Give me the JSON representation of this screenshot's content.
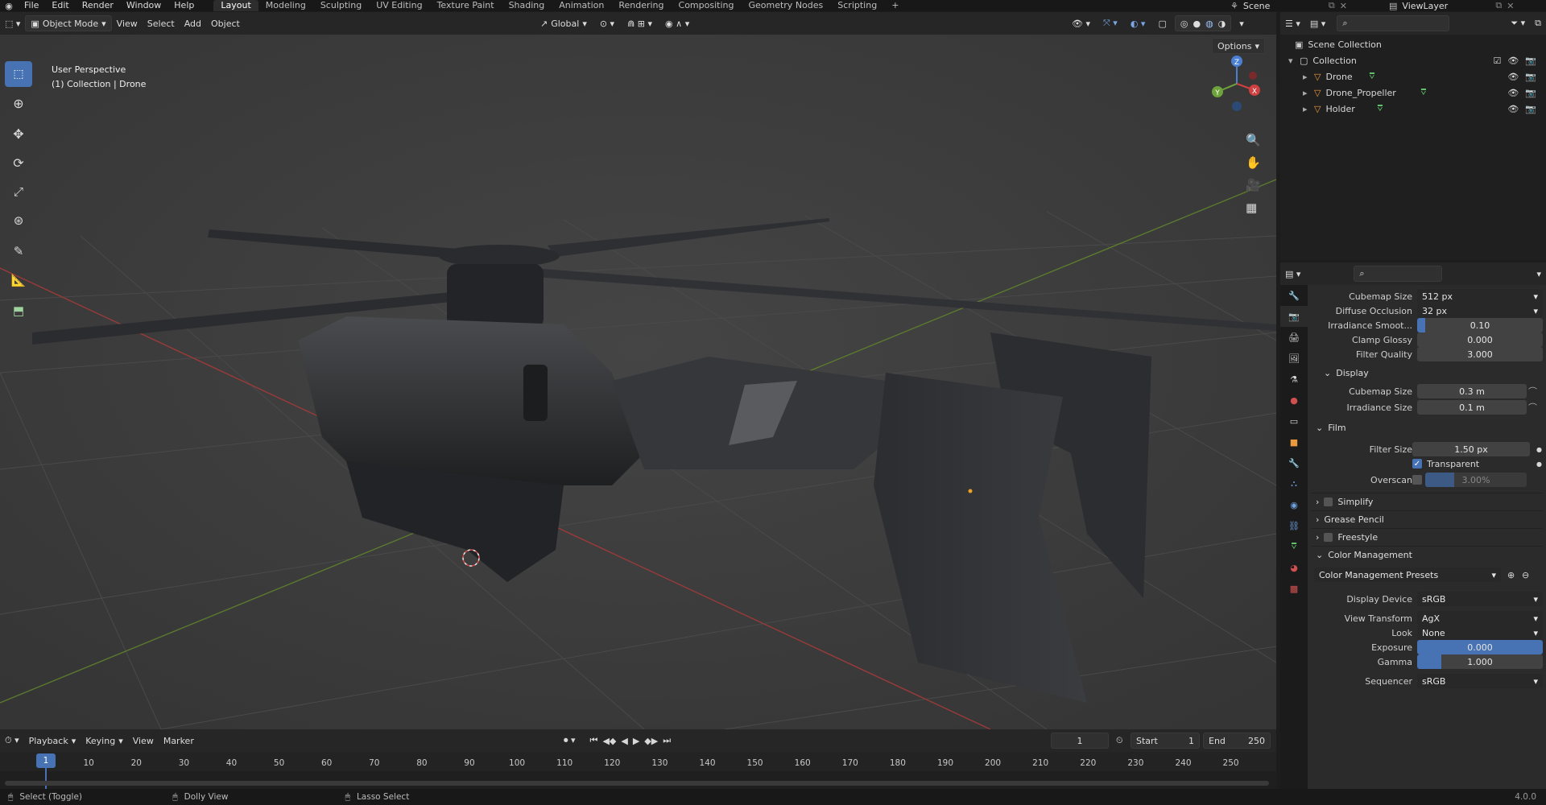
{
  "topbar": {
    "menus": [
      "File",
      "Edit",
      "Render",
      "Window",
      "Help"
    ],
    "workspaces": [
      "Layout",
      "Modeling",
      "Sculpting",
      "UV Editing",
      "Texture Paint",
      "Shading",
      "Animation",
      "Rendering",
      "Compositing",
      "Geometry Nodes",
      "Scripting"
    ],
    "active_workspace": "Layout",
    "scene": "Scene",
    "view_layer": "ViewLayer"
  },
  "viewport_header": {
    "mode": "Object Mode",
    "menus": [
      "View",
      "Select",
      "Add",
      "Object"
    ],
    "orientation": "Global",
    "options": "Options"
  },
  "viewport": {
    "overlay_line1": "User Perspective",
    "overlay_line2": "(1) Collection | Drone",
    "gizmo_axes": [
      "Z",
      "Y",
      "X"
    ]
  },
  "outliner": {
    "root": "Scene Collection",
    "collection": "Collection",
    "objects": [
      "Drone",
      "Drone_Propeller",
      "Holder"
    ]
  },
  "properties": {
    "rows_top": [
      {
        "label": "Cubemap Size",
        "value": "512 px",
        "kind": "dropdown"
      },
      {
        "label": "Diffuse Occlusion",
        "value": "32 px",
        "kind": "dropdown"
      },
      {
        "label": "Irradiance Smoot...",
        "value": "0.10",
        "kind": "slider"
      },
      {
        "label": "Clamp Glossy",
        "value": "0.000",
        "kind": "number"
      },
      {
        "label": "Filter Quality",
        "value": "3.000",
        "kind": "number"
      }
    ],
    "display_section": "Display",
    "display_rows": [
      {
        "label": "Cubemap Size",
        "value": "0.3 m"
      },
      {
        "label": "Irradiance Size",
        "value": "0.1 m"
      }
    ],
    "film_section": "Film",
    "film": {
      "filter_size_label": "Filter Size",
      "filter_size": "1.50 px",
      "transparent_label": "Transparent",
      "overscan_label": "Overscan",
      "overscan": "3.00%"
    },
    "collapsed_sections": [
      "Simplify",
      "Grease Pencil",
      "Freestyle"
    ],
    "color_section": "Color Management",
    "presets": "Color Management Presets",
    "color_rows": [
      {
        "label": "Display Device",
        "value": "sRGB",
        "kind": "dropdown"
      },
      {
        "label": "View Transform",
        "value": "AgX",
        "kind": "dropdown"
      },
      {
        "label": "Look",
        "value": "None",
        "kind": "dropdown"
      },
      {
        "label": "Exposure",
        "value": "0.000",
        "kind": "slider"
      },
      {
        "label": "Gamma",
        "value": "1.000",
        "kind": "slider"
      },
      {
        "label": "Sequencer",
        "value": "sRGB",
        "kind": "dropdown"
      }
    ]
  },
  "timeline": {
    "menus": [
      "Playback",
      "Keying",
      "View",
      "Marker"
    ],
    "current_frame": "1",
    "start_label": "Start",
    "start": "1",
    "end_label": "End",
    "end": "250",
    "ticks": [
      "10",
      "20",
      "30",
      "40",
      "50",
      "60",
      "70",
      "80",
      "90",
      "100",
      "110",
      "120",
      "130",
      "140",
      "150",
      "160",
      "170",
      "180",
      "190",
      "200",
      "210",
      "220",
      "230",
      "240",
      "250"
    ],
    "playhead": "1"
  },
  "statusbar": {
    "select": "Select (Toggle)",
    "dolly": "Dolly View",
    "lasso": "Lasso Select",
    "version": "4.0.0"
  }
}
